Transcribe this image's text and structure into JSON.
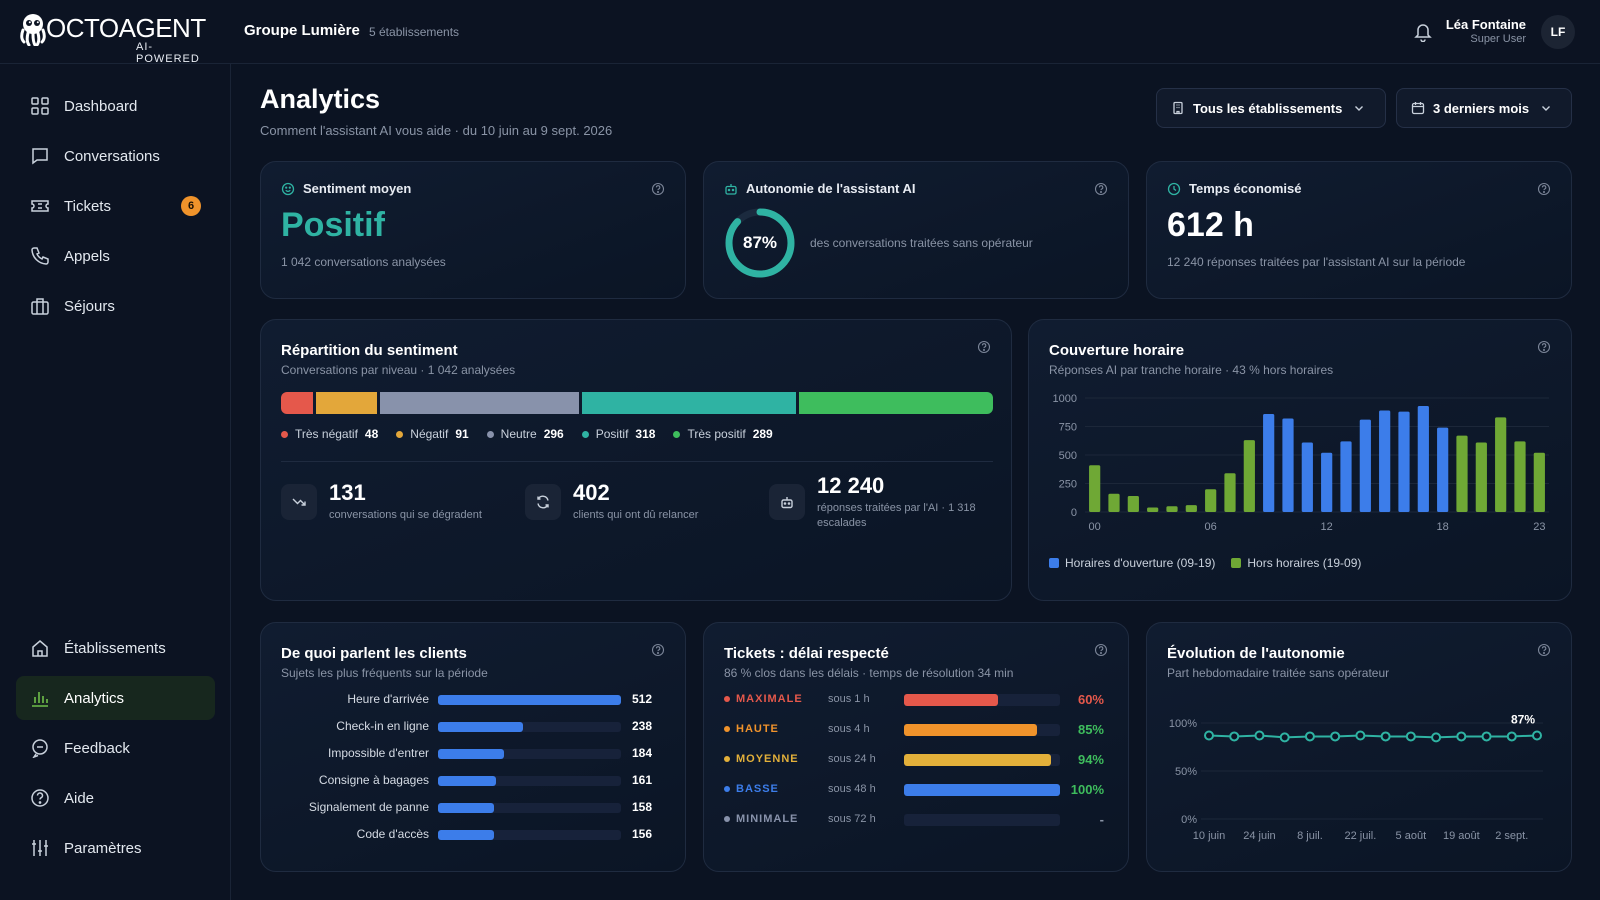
{
  "brand": {
    "name": "OCTOAGENT",
    "tagline": "AI-POWERED"
  },
  "org": {
    "name": "Groupe Lumière",
    "count": "5 établissements"
  },
  "user": {
    "name": "Léa Fontaine",
    "role": "Super User",
    "initials": "LF"
  },
  "sidebar": {
    "top": [
      {
        "label": "Dashboard",
        "icon": "grid-icon"
      },
      {
        "label": "Conversations",
        "icon": "chat-icon"
      },
      {
        "label": "Tickets",
        "icon": "ticket-icon",
        "badge": "6"
      },
      {
        "label": "Appels",
        "icon": "phone-icon"
      },
      {
        "label": "Séjours",
        "icon": "suitcase-icon"
      }
    ],
    "bottom": [
      {
        "label": "Établissements",
        "icon": "home-icon"
      },
      {
        "label": "Analytics",
        "icon": "bar-chart-icon",
        "active": true
      },
      {
        "label": "Feedback",
        "icon": "feedback-icon"
      },
      {
        "label": "Aide",
        "icon": "help-icon"
      },
      {
        "label": "Paramètres",
        "icon": "sliders-icon"
      }
    ]
  },
  "header": {
    "title": "Analytics",
    "subtitle": "Comment l'assistant AI vous aide · du 10 juin au 9 sept. 2026",
    "filter_establishments": "Tous les établissements",
    "filter_period": "3 derniers mois"
  },
  "kpis": {
    "sentiment": {
      "label": "Sentiment moyen",
      "value": "Positif",
      "note": "1 042 conversations analysées"
    },
    "autonomy": {
      "label": "Autonomie de l'assistant AI",
      "value": "87%",
      "fraction": 0.87,
      "note": "des conversations traitées sans opérateur"
    },
    "time": {
      "label": "Temps économisé",
      "value": "612 h",
      "note": "12 240 réponses traitées par l'assistant AI sur la période"
    }
  },
  "sentiment_split": {
    "title": "Répartition du sentiment",
    "subtitle": "Conversations par niveau · 1 042 analysées",
    "levels": [
      {
        "label": "Très négatif",
        "value": 48,
        "color": "#e5584b"
      },
      {
        "label": "Négatif",
        "value": 91,
        "color": "#e3a73a"
      },
      {
        "label": "Neutre",
        "value": 296,
        "color": "#8892ab"
      },
      {
        "label": "Positif",
        "value": 318,
        "color": "#2fb3a3"
      },
      {
        "label": "Très positif",
        "value": 289,
        "color": "#3ebd5d"
      }
    ],
    "stats": [
      {
        "value": "131",
        "label": "conversations qui se dégradent",
        "icon": "trend-down-icon"
      },
      {
        "value": "402",
        "label": "clients qui ont dû relancer",
        "icon": "refresh-icon"
      },
      {
        "value": "12 240",
        "label": "réponses traitées par l'AI · 1 318 escalades",
        "icon": "robot-icon"
      }
    ]
  },
  "coverage": {
    "title": "Couverture horaire",
    "subtitle": "Réponses AI par tranche horaire · 43 % hors horaires",
    "legend_open": "Horaires d'ouverture (09-19)",
    "legend_off": "Hors horaires (19-09)",
    "color_open": "#3c7dea",
    "color_off": "#6fa835"
  },
  "topics": {
    "title": "De quoi parlent les clients",
    "subtitle": "Sujets les plus fréquents sur la période",
    "max": 512,
    "items": [
      {
        "label": "Heure d'arrivée",
        "value": 512
      },
      {
        "label": "Check-in en ligne",
        "value": 238
      },
      {
        "label": "Impossible d'entrer",
        "value": 184
      },
      {
        "label": "Consigne à bagages",
        "value": 161
      },
      {
        "label": "Signalement de panne",
        "value": 158
      },
      {
        "label": "Code d'accès",
        "value": 156
      }
    ]
  },
  "tickets": {
    "title": "Tickets : délai respecté",
    "subtitle": "86 % clos dans les délais · temps de résolution 34 min",
    "rows": [
      {
        "label": "MAXIMALE",
        "sla": "sous 1 h",
        "pct": "60%",
        "fraction": 0.6,
        "color": "#e5584b",
        "pct_color": "#e5584b"
      },
      {
        "label": "HAUTE",
        "sla": "sous 4 h",
        "pct": "85%",
        "fraction": 0.85,
        "color": "#f0932b",
        "pct_color": "#3ebd5d"
      },
      {
        "label": "MOYENNE",
        "sla": "sous 24 h",
        "pct": "94%",
        "fraction": 0.94,
        "color": "#e3b03a",
        "pct_color": "#3ebd5d"
      },
      {
        "label": "BASSE",
        "sla": "sous 48 h",
        "pct": "100%",
        "fraction": 1.0,
        "color": "#3c7dea",
        "pct_color": "#3ebd5d"
      },
      {
        "label": "MINIMALE",
        "sla": "sous 72 h",
        "pct": "-",
        "fraction": 0,
        "color": "#8892ab",
        "pct_color": "#8a94a6"
      }
    ]
  },
  "autonomy_trend": {
    "title": "Évolution de l'autonomie",
    "subtitle": "Part hebdomadaire traitée sans opérateur",
    "last_label": "87%"
  },
  "chart_data": [
    {
      "type": "bar",
      "title": "Couverture horaire",
      "x": [
        0,
        1,
        2,
        3,
        4,
        5,
        6,
        7,
        8,
        9,
        10,
        11,
        12,
        13,
        14,
        15,
        16,
        17,
        18,
        19,
        20,
        21,
        22,
        23
      ],
      "x_tick_labels": [
        "00",
        "06",
        "12",
        "18",
        "23"
      ],
      "series": [
        {
          "name": "Horaires d'ouverture (09-19)",
          "values": [
            null,
            null,
            null,
            null,
            null,
            null,
            null,
            null,
            null,
            860,
            820,
            610,
            520,
            620,
            810,
            890,
            880,
            930,
            740,
            null,
            null,
            null,
            null,
            null
          ]
        },
        {
          "name": "Hors horaires (19-09)",
          "values": [
            410,
            160,
            140,
            40,
            50,
            60,
            200,
            340,
            630,
            null,
            null,
            null,
            null,
            null,
            null,
            null,
            null,
            null,
            null,
            670,
            610,
            830,
            620,
            520
          ]
        }
      ],
      "ylim": [
        0,
        1000
      ],
      "y_ticks": [
        0,
        250,
        500,
        750,
        1000
      ],
      "legend": "bottom-left"
    },
    {
      "type": "line",
      "title": "Évolution de l'autonomie",
      "x": [
        "10 juin",
        "17 juin",
        "24 juin",
        "1 juil.",
        "8 juil.",
        "15 juil.",
        "22 juil.",
        "29 juil.",
        "5 août",
        "12 août",
        "19 août",
        "26 août",
        "2 sept.",
        "9 sept."
      ],
      "x_tick_labels": [
        "10 juin",
        "24 juin",
        "8 juil.",
        "22 juil.",
        "5 août",
        "19 août",
        "2 sept."
      ],
      "series": [
        {
          "values": [
            87,
            86,
            87,
            85,
            86,
            86,
            87,
            86,
            86,
            85,
            86,
            86,
            86,
            87
          ]
        }
      ],
      "ylim": [
        0,
        100
      ],
      "y_ticks": [
        "0%",
        "50%",
        "100%"
      ],
      "color": "#2fb3a3"
    }
  ]
}
